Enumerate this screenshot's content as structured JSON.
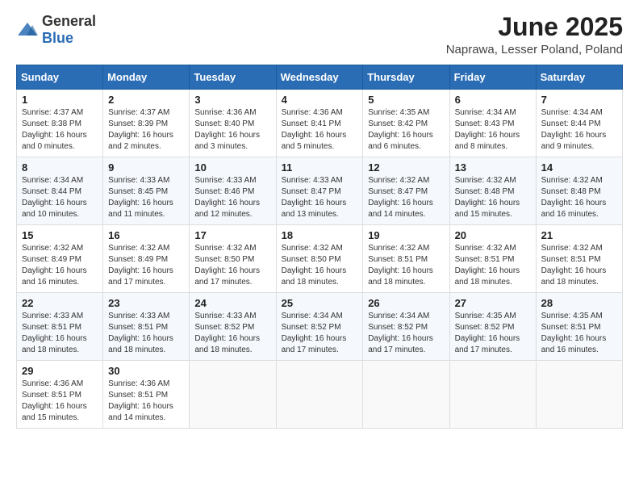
{
  "header": {
    "logo_general": "General",
    "logo_blue": "Blue",
    "month_title": "June 2025",
    "location": "Naprawa, Lesser Poland, Poland"
  },
  "weekdays": [
    "Sunday",
    "Monday",
    "Tuesday",
    "Wednesday",
    "Thursday",
    "Friday",
    "Saturday"
  ],
  "weeks": [
    [
      {
        "day": "1",
        "sunrise": "4:37 AM",
        "sunset": "8:38 PM",
        "daylight": "16 hours and 0 minutes."
      },
      {
        "day": "2",
        "sunrise": "4:37 AM",
        "sunset": "8:39 PM",
        "daylight": "16 hours and 2 minutes."
      },
      {
        "day": "3",
        "sunrise": "4:36 AM",
        "sunset": "8:40 PM",
        "daylight": "16 hours and 3 minutes."
      },
      {
        "day": "4",
        "sunrise": "4:36 AM",
        "sunset": "8:41 PM",
        "daylight": "16 hours and 5 minutes."
      },
      {
        "day": "5",
        "sunrise": "4:35 AM",
        "sunset": "8:42 PM",
        "daylight": "16 hours and 6 minutes."
      },
      {
        "day": "6",
        "sunrise": "4:34 AM",
        "sunset": "8:43 PM",
        "daylight": "16 hours and 8 minutes."
      },
      {
        "day": "7",
        "sunrise": "4:34 AM",
        "sunset": "8:44 PM",
        "daylight": "16 hours and 9 minutes."
      }
    ],
    [
      {
        "day": "8",
        "sunrise": "4:34 AM",
        "sunset": "8:44 PM",
        "daylight": "16 hours and 10 minutes."
      },
      {
        "day": "9",
        "sunrise": "4:33 AM",
        "sunset": "8:45 PM",
        "daylight": "16 hours and 11 minutes."
      },
      {
        "day": "10",
        "sunrise": "4:33 AM",
        "sunset": "8:46 PM",
        "daylight": "16 hours and 12 minutes."
      },
      {
        "day": "11",
        "sunrise": "4:33 AM",
        "sunset": "8:47 PM",
        "daylight": "16 hours and 13 minutes."
      },
      {
        "day": "12",
        "sunrise": "4:32 AM",
        "sunset": "8:47 PM",
        "daylight": "16 hours and 14 minutes."
      },
      {
        "day": "13",
        "sunrise": "4:32 AM",
        "sunset": "8:48 PM",
        "daylight": "16 hours and 15 minutes."
      },
      {
        "day": "14",
        "sunrise": "4:32 AM",
        "sunset": "8:48 PM",
        "daylight": "16 hours and 16 minutes."
      }
    ],
    [
      {
        "day": "15",
        "sunrise": "4:32 AM",
        "sunset": "8:49 PM",
        "daylight": "16 hours and 16 minutes."
      },
      {
        "day": "16",
        "sunrise": "4:32 AM",
        "sunset": "8:49 PM",
        "daylight": "16 hours and 17 minutes."
      },
      {
        "day": "17",
        "sunrise": "4:32 AM",
        "sunset": "8:50 PM",
        "daylight": "16 hours and 17 minutes."
      },
      {
        "day": "18",
        "sunrise": "4:32 AM",
        "sunset": "8:50 PM",
        "daylight": "16 hours and 18 minutes."
      },
      {
        "day": "19",
        "sunrise": "4:32 AM",
        "sunset": "8:51 PM",
        "daylight": "16 hours and 18 minutes."
      },
      {
        "day": "20",
        "sunrise": "4:32 AM",
        "sunset": "8:51 PM",
        "daylight": "16 hours and 18 minutes."
      },
      {
        "day": "21",
        "sunrise": "4:32 AM",
        "sunset": "8:51 PM",
        "daylight": "16 hours and 18 minutes."
      }
    ],
    [
      {
        "day": "22",
        "sunrise": "4:33 AM",
        "sunset": "8:51 PM",
        "daylight": "16 hours and 18 minutes."
      },
      {
        "day": "23",
        "sunrise": "4:33 AM",
        "sunset": "8:51 PM",
        "daylight": "16 hours and 18 minutes."
      },
      {
        "day": "24",
        "sunrise": "4:33 AM",
        "sunset": "8:52 PM",
        "daylight": "16 hours and 18 minutes."
      },
      {
        "day": "25",
        "sunrise": "4:34 AM",
        "sunset": "8:52 PM",
        "daylight": "16 hours and 17 minutes."
      },
      {
        "day": "26",
        "sunrise": "4:34 AM",
        "sunset": "8:52 PM",
        "daylight": "16 hours and 17 minutes."
      },
      {
        "day": "27",
        "sunrise": "4:35 AM",
        "sunset": "8:52 PM",
        "daylight": "16 hours and 17 minutes."
      },
      {
        "day": "28",
        "sunrise": "4:35 AM",
        "sunset": "8:51 PM",
        "daylight": "16 hours and 16 minutes."
      }
    ],
    [
      {
        "day": "29",
        "sunrise": "4:36 AM",
        "sunset": "8:51 PM",
        "daylight": "16 hours and 15 minutes."
      },
      {
        "day": "30",
        "sunrise": "4:36 AM",
        "sunset": "8:51 PM",
        "daylight": "16 hours and 14 minutes."
      },
      null,
      null,
      null,
      null,
      null
    ]
  ],
  "labels": {
    "sunrise": "Sunrise:",
    "sunset": "Sunset:",
    "daylight": "Daylight:"
  }
}
